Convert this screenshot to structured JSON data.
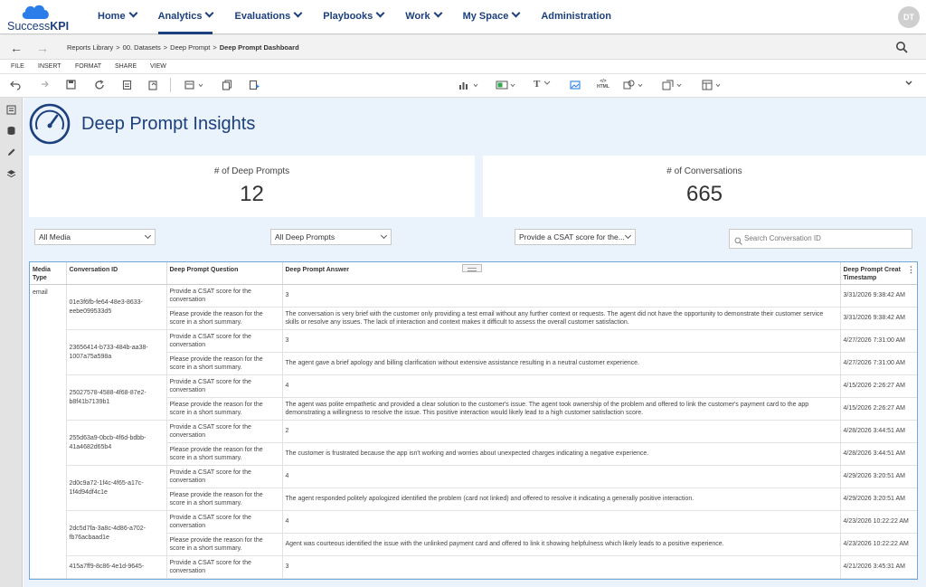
{
  "app": {
    "brand_light": "Success",
    "brand_bold": "KPI",
    "user_initials": "DT"
  },
  "nav": [
    {
      "label": "Home",
      "dropdown": true,
      "active": false
    },
    {
      "label": "Analytics",
      "dropdown": true,
      "active": true
    },
    {
      "label": "Evaluations",
      "dropdown": true,
      "active": false
    },
    {
      "label": "Playbooks",
      "dropdown": true,
      "active": false
    },
    {
      "label": "Work",
      "dropdown": true,
      "active": false
    },
    {
      "label": "My Space",
      "dropdown": true,
      "active": false
    },
    {
      "label": "Administration",
      "dropdown": false,
      "active": false
    }
  ],
  "breadcrumb": {
    "items": [
      "Reports Library",
      "00. Datasets",
      "Deep Prompt"
    ],
    "separator": ">",
    "current": "Deep Prompt Dashboard"
  },
  "menu": [
    "FILE",
    "INSERT",
    "FORMAT",
    "SHARE",
    "VIEW"
  ],
  "toolbar_icons": [
    "undo-icon",
    "redo-icon",
    "save-icon",
    "refresh-icon",
    "data-icon",
    "export-icon",
    "add-dataset-icon",
    "copy-icon",
    "new-page-icon",
    "chart-icon",
    "kpi-icon",
    "text-icon",
    "image-icon",
    "html-icon",
    "shapes-icon",
    "filter-icon",
    "layout-icon"
  ],
  "toolbar_text": {
    "text_glyph": "T",
    "html_glyph": "HTML"
  },
  "page": {
    "title": "Deep Prompt Insights"
  },
  "kpis": [
    {
      "label": "# of Deep Prompts",
      "value": "12"
    },
    {
      "label": "# of Conversations",
      "value": "665"
    }
  ],
  "filters": {
    "media": "All Media",
    "deep_prompts": "All Deep Prompts",
    "question": "Provide a CSAT score for the...",
    "search_placeholder": "Search Conversation ID"
  },
  "table": {
    "columns": [
      "Media Type",
      "Conversation ID",
      "Deep Prompt Question",
      "Deep Prompt Answer",
      "Deep Prompt Creat Timestamp"
    ],
    "media_value": "email",
    "conversations": [
      {
        "id": "01e3f6fb-fe64-48e3-8633-eebe099533d5",
        "rows": [
          {
            "q": "Provide a CSAT score for the conversation",
            "a": "3",
            "ts": "3/31/2026 9:38:42 AM"
          },
          {
            "q": "Please provide the reason for the score in a short summary.",
            "a": "The conversation is very brief with the customer only providing a test email without any further context or requests. The agent did not have the opportunity to demonstrate their customer service skills or resolve any issues. The lack of interaction and context makes it difficult to assess the overall customer satisfaction.",
            "ts": "3/31/2026 9:38:42 AM"
          }
        ]
      },
      {
        "id": "23656414-b733-484b-aa38-1007a75a598a",
        "rows": [
          {
            "q": "Provide a CSAT score for the conversation",
            "a": "3",
            "ts": "4/27/2026 7:31:00 AM"
          },
          {
            "q": "Please provide the reason for the score in a short summary.",
            "a": "The agent gave a brief apology and billing clarification without extensive assistance resulting in a neutral customer experience.",
            "ts": "4/27/2026 7:31:00 AM"
          }
        ]
      },
      {
        "id": "25027578-4588-4f68-87e2-b8f41b7139b1",
        "rows": [
          {
            "q": "Provide a CSAT score for the conversation",
            "a": "4",
            "ts": "4/15/2026 2:26:27 AM"
          },
          {
            "q": "Please provide the reason for the score in a short summary.",
            "a": "The agent was polite empathetic and provided a clear solution to the customer's issue. The agent took ownership of the problem and offered to link the customer's payment card to the app demonstrating a willingness to resolve the issue. This positive interaction would likely lead to a high customer satisfaction score.",
            "ts": "4/15/2026 2:26:27 AM"
          }
        ]
      },
      {
        "id": "255d63a9-0bcb-4f6d-bdbb-41a4682d65b4",
        "rows": [
          {
            "q": "Provide a CSAT score for the conversation",
            "a": "2",
            "ts": "4/28/2026 3:44:51 AM"
          },
          {
            "q": "Please provide the reason for the score in a short summary.",
            "a": "The customer is frustrated because the app isn't working and worries about unexpected charges indicating a negative experience.",
            "ts": "4/28/2026 3:44:51 AM"
          }
        ]
      },
      {
        "id": "2d0c9a72-1f4c-4f65-a17c-1f4d94df4c1e",
        "rows": [
          {
            "q": "Provide a CSAT score for the conversation",
            "a": "4",
            "ts": "4/29/2026 3:20:51 AM"
          },
          {
            "q": "Please provide the reason for the score in a short summary.",
            "a": "The agent responded politely apologized identified the problem (card not linked) and offered to resolve it indicating a generally positive interaction.",
            "ts": "4/29/2026 3:20:51 AM"
          }
        ]
      },
      {
        "id": "2dc5d7fa-3a8c-4d86-a702-fb76acbaad1e",
        "rows": [
          {
            "q": "Provide a CSAT score for the conversation",
            "a": "4",
            "ts": "4/23/2026 10:22:22 AM"
          },
          {
            "q": "Please provide the reason for the score in a short summary.",
            "a": "Agent was courteous identified the issue with the unlinked payment card and offered to link it showing helpfulness which likely leads to a positive experience.",
            "ts": "4/23/2026 10:22:22 AM"
          }
        ]
      },
      {
        "id": "415a7ff9-8c86-4e1d-9645-",
        "rows": [
          {
            "q": "Provide a CSAT score for the conversation",
            "a": "3",
            "ts": "4/21/2026 3:45:31 AM"
          }
        ]
      }
    ]
  },
  "colors": {
    "brand": "#1c3f7e",
    "accent_blue": "#2b7de9",
    "canvas": "#eaf2fb",
    "table_border": "#6fa8dc"
  }
}
